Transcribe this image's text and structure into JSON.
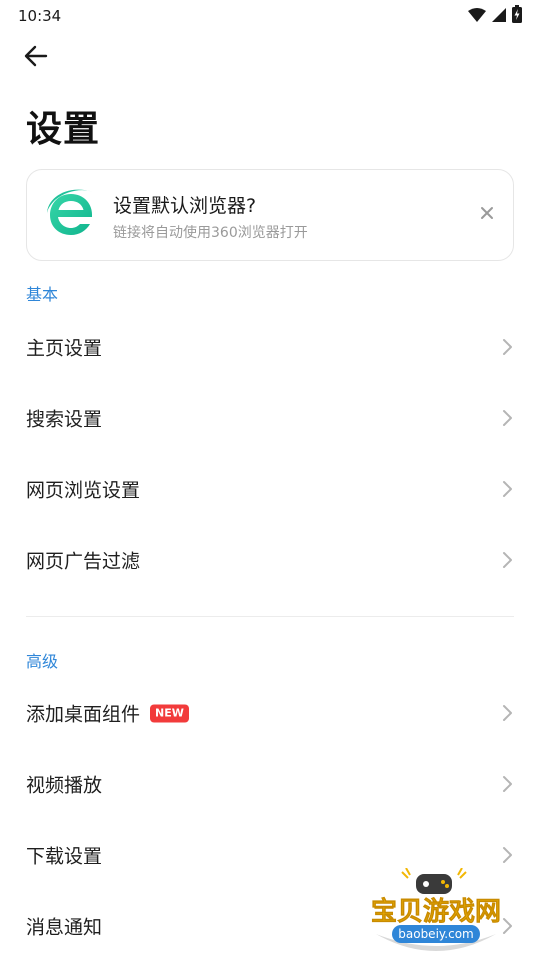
{
  "status_bar": {
    "time": "10:34",
    "icons": [
      "wifi-icon",
      "signal-icon",
      "battery-charging-icon"
    ]
  },
  "header": {
    "back_icon": "arrow-left-icon",
    "title": "设置"
  },
  "promo": {
    "title": "设置默认浏览器?",
    "subtitle": "链接将自动使用360浏览器打开",
    "logo_icon": "browser-e-logo",
    "close_icon": "close-icon"
  },
  "sections": {
    "basic": {
      "title": "基本",
      "items": [
        {
          "label": "主页设置"
        },
        {
          "label": "搜索设置"
        },
        {
          "label": "网页浏览设置"
        },
        {
          "label": "网页广告过滤"
        }
      ]
    },
    "advanced": {
      "title": "高级",
      "items": [
        {
          "label": "添加桌面组件",
          "badge": "NEW"
        },
        {
          "label": "视频播放"
        },
        {
          "label": "下载设置"
        },
        {
          "label": "消息通知"
        }
      ]
    }
  },
  "watermark": {
    "text": "宝贝游戏网",
    "url": "baobeiy.com"
  },
  "colors": {
    "accent": "#2f86d8",
    "badge": "#f23b3b",
    "logo_green": "#1fc29a"
  }
}
